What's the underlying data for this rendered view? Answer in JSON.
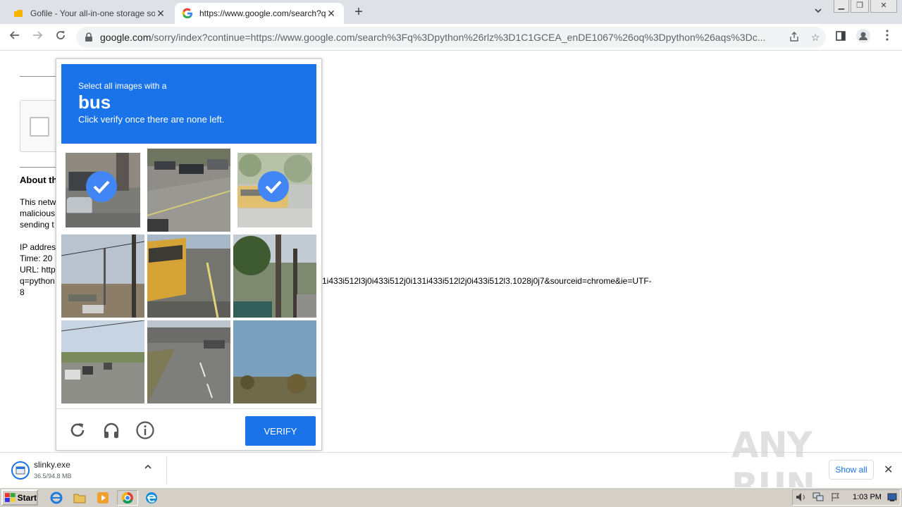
{
  "tabs": [
    {
      "title": "Gofile - Your all-in-one storage soluti",
      "icon": "gofile-icon",
      "active": false
    },
    {
      "title": "https://www.google.com/search?q=",
      "icon": "google-icon",
      "active": true
    }
  ],
  "toolbar": {
    "url_host": "google.com",
    "url_path": "/sorry/index?continue=https://www.google.com/search%3Fq%3Dpython%26rlz%3D1C1GCEA_enDE1067%26oq%3Dpython%26aqs%3Dc..."
  },
  "page": {
    "about_title": "About this page",
    "lines": [
      "This network",
      "malicious",
      "sending t",
      "IP address",
      "Time: 20",
      "URL: http",
      "q=python",
      "8"
    ],
    "url_tail": "1i433i512l3j0i433i512j0i131i433i512l2j0i433i512l3.1028j0j7&sourceid=chrome&ie=UTF-"
  },
  "captcha": {
    "instruction_line1": "Select all images with a",
    "keyword": "bus",
    "instruction_line2": "Click verify once there are none left.",
    "verify_label": "VERIFY",
    "tiles": [
      {
        "selected": true
      },
      {
        "selected": false
      },
      {
        "selected": true
      },
      {
        "selected": false
      },
      {
        "selected": false
      },
      {
        "selected": false
      },
      {
        "selected": false
      },
      {
        "selected": false
      },
      {
        "selected": false
      }
    ],
    "colors": {
      "header": "#1a73e8",
      "check": "#4285f4"
    }
  },
  "download": {
    "file_name": "slinky.exe",
    "progress": "36.5/94.8 MB",
    "show_all_label": "Show all"
  },
  "watermark": "ANY RUN",
  "taskbar": {
    "start_label": "Start",
    "clock": "1:03 PM"
  }
}
